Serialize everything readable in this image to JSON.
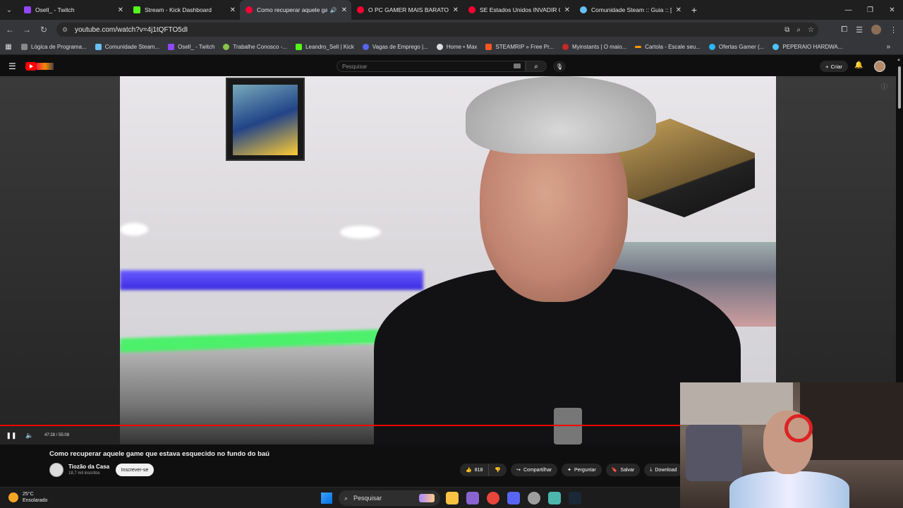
{
  "tabs": [
    {
      "title": "Osell_ - Twitch",
      "favicon_color": "#9146ff",
      "active": false
    },
    {
      "title": "Stream - Kick Dashboard",
      "favicon_color": "#53fc18",
      "active": false
    },
    {
      "title": "Como recuperar aquele ga",
      "favicon_color": "#ff0033",
      "active": true,
      "audio": true
    },
    {
      "title": "O PC GAMER MAIS BARATO DO",
      "favicon_color": "#ff0033",
      "active": false
    },
    {
      "title": "SE Estados Unidos INVADIR O",
      "favicon_color": "#ff0033",
      "active": false
    },
    {
      "title": "Comunidade Steam :: Guia :: [P",
      "favicon_color": "#66c0f4",
      "active": false
    }
  ],
  "address": {
    "url": "youtube.com/watch?v=4j1tQFTO5dI"
  },
  "bookmarks": [
    {
      "label": "Lógica de Programa...",
      "color": "#888"
    },
    {
      "label": "Comunidade Steam...",
      "color": "#66c0f4"
    },
    {
      "label": "Osell_ - Twitch",
      "color": "#9146ff"
    },
    {
      "label": "Trabalhe Conosco -...",
      "color": "#8bc34a"
    },
    {
      "label": "Leandro_Sell | Kick",
      "color": "#53fc18"
    },
    {
      "label": "Vagas de Emprego |...",
      "color": "#5865f2"
    },
    {
      "label": "Home • Max",
      "color": "#ddd"
    },
    {
      "label": "STEAMRIP » Free Pr...",
      "color": "#ff5722"
    },
    {
      "label": "Myinstants | O maio...",
      "color": "#c62828"
    },
    {
      "label": "Cartola - Escale seu...",
      "color": "#ff9800"
    },
    {
      "label": "Ofertas Gamer (...",
      "color": "#29b6f6"
    },
    {
      "label": "PEPERAIO HARDWA...",
      "color": "#4fc3f7"
    }
  ],
  "youtube": {
    "search_placeholder": "Pesquisar",
    "create_label": "Criar"
  },
  "player": {
    "time": "47:28 / 55:08",
    "progress_fraction": 0.861
  },
  "video": {
    "title": "Como recuperar aquele game que estava esquecido no fundo do baú",
    "channel": "Tiozão da Casa",
    "subscribers": "18,7 mil inscritos",
    "subscribe_label": "Inscrever-se",
    "likes": "818",
    "share_label": "Compartilhar",
    "ask_label": "Perguntar",
    "save_label": "Salvar",
    "download_label": "Download"
  },
  "taskbar": {
    "temperature": "25°C",
    "condition": "Ensolarado",
    "search_label": "Pesquisar",
    "apps": [
      "#f8c342",
      "#8a63d2",
      "#e8453c",
      "#5865f2",
      "#9e9e9e",
      "#4db6ac",
      "#1b2838"
    ]
  }
}
